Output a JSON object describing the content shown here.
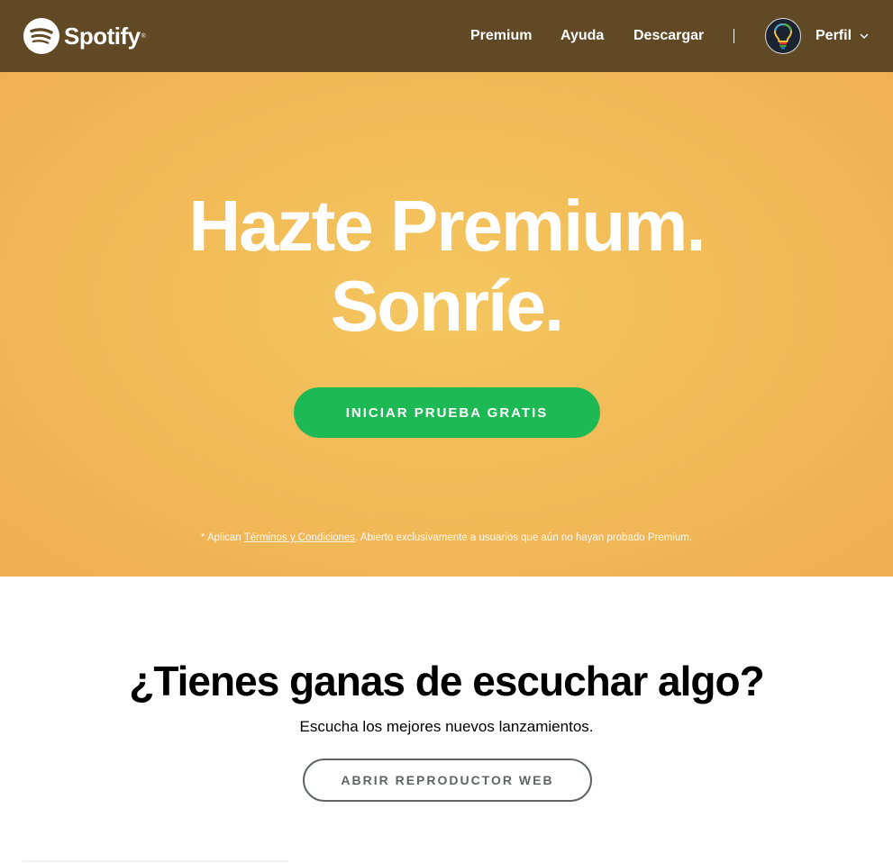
{
  "header": {
    "logo_text": "Spotify",
    "logo_reg": "®",
    "nav": {
      "premium": "Premium",
      "help": "Ayuda",
      "download": "Descargar",
      "profile": "Perfil"
    },
    "icons": {
      "logo": "spotify-logo-icon",
      "avatar": "lightbulb-avatar-icon",
      "chevron": "chevron-down-icon"
    }
  },
  "hero": {
    "title_line1": "Hazte Premium.",
    "title_line2": "Sonríe.",
    "cta_label": "INICIAR PRUEBA GRATIS",
    "disclaimer_prefix": "* Aplican ",
    "disclaimer_link": "Términos y Condiciones",
    "disclaimer_suffix": ". Abierto exclusivamente a usuarios que aún no hayan probado Premium."
  },
  "section": {
    "title": "¿Tienes ganas de escuchar algo?",
    "subtitle": "Escucha los mejores nuevos lanzamientos.",
    "button_label": "ABRIR REPRODUCTOR WEB"
  },
  "colors": {
    "header_bg": "#614926",
    "hero_bg": "#f2bb58",
    "cta_green": "#1db954",
    "outline_button": "#616467"
  }
}
